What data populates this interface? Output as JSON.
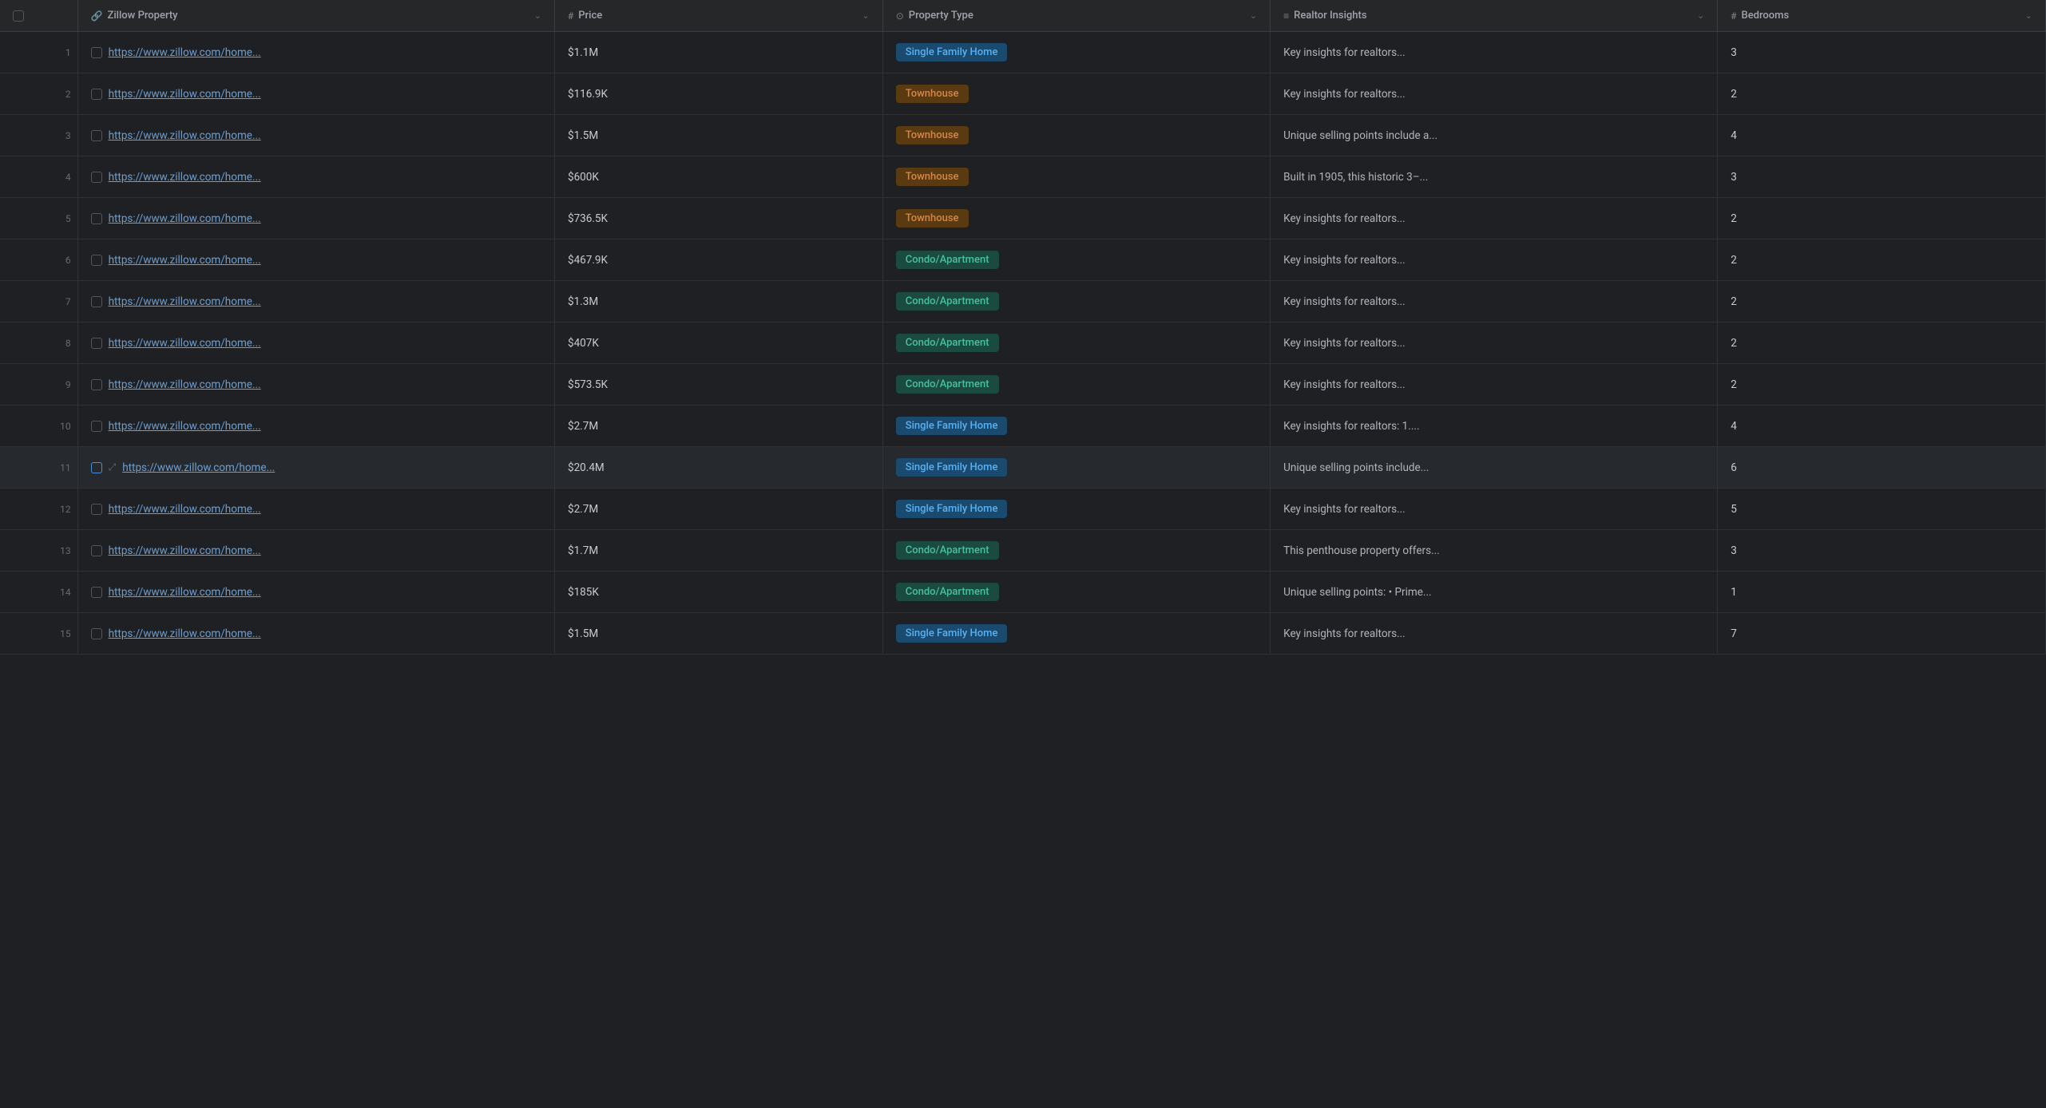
{
  "colors": {
    "bg": "#1e2023",
    "headerBg": "#252729",
    "rowHover": "#262a2e",
    "border": "#2e3135",
    "headerBorder": "#3a3d42",
    "text": "#c8ccd2",
    "subtext": "#a0a4ab",
    "rowNum": "#666b75",
    "link": "#6b9fd4",
    "singleFamilyBg": "#1a4a6e",
    "singleFamilyText": "#5ab0f0",
    "townhouseBg": "#5a3a10",
    "townhouseText": "#d4864a",
    "condoBg": "#1a4a40",
    "condoText": "#4abfa0"
  },
  "columns": [
    {
      "id": "row-num",
      "label": "",
      "icon": ""
    },
    {
      "id": "zillow",
      "label": "Zillow Property",
      "icon": "🔗"
    },
    {
      "id": "price",
      "label": "Price",
      "icon": "#"
    },
    {
      "id": "property-type",
      "label": "Property Type",
      "icon": "⊙"
    },
    {
      "id": "realtor-insights",
      "label": "Realtor Insights",
      "icon": "≡"
    },
    {
      "id": "bedrooms",
      "label": "Bedrooms",
      "icon": "#"
    }
  ],
  "rows": [
    {
      "num": 1,
      "url": "https://www.zillow.com/home...",
      "price": "$1.1M",
      "property_type": "Single Family Home",
      "property_type_class": "single-family",
      "insights": "Key insights for realtors...",
      "bedrooms": "3",
      "checked": false,
      "highlighted": false
    },
    {
      "num": 2,
      "url": "https://www.zillow.com/home...",
      "price": "$116.9K",
      "property_type": "Townhouse",
      "property_type_class": "townhouse",
      "insights": "Key insights for realtors...",
      "bedrooms": "2",
      "checked": false,
      "highlighted": false
    },
    {
      "num": 3,
      "url": "https://www.zillow.com/home...",
      "price": "$1.5M",
      "property_type": "Townhouse",
      "property_type_class": "townhouse",
      "insights": "Unique selling points include a...",
      "bedrooms": "4",
      "checked": false,
      "highlighted": false
    },
    {
      "num": 4,
      "url": "https://www.zillow.com/home...",
      "price": "$600K",
      "property_type": "Townhouse",
      "property_type_class": "townhouse",
      "insights": "Built in 1905, this historic 3–...",
      "bedrooms": "3",
      "checked": false,
      "highlighted": false
    },
    {
      "num": 5,
      "url": "https://www.zillow.com/home...",
      "price": "$736.5K",
      "property_type": "Townhouse",
      "property_type_class": "townhouse",
      "insights": "Key insights for realtors...",
      "bedrooms": "2",
      "checked": false,
      "highlighted": false
    },
    {
      "num": 6,
      "url": "https://www.zillow.com/home...",
      "price": "$467.9K",
      "property_type": "Condo/Apartment",
      "property_type_class": "condo",
      "insights": "Key insights for realtors...",
      "bedrooms": "2",
      "checked": false,
      "highlighted": false
    },
    {
      "num": 7,
      "url": "https://www.zillow.com/home...",
      "price": "$1.3M",
      "property_type": "Condo/Apartment",
      "property_type_class": "condo",
      "insights": "Key insights for realtors...",
      "bedrooms": "2",
      "checked": false,
      "highlighted": false
    },
    {
      "num": 8,
      "url": "https://www.zillow.com/home...",
      "price": "$407K",
      "property_type": "Condo/Apartment",
      "property_type_class": "condo",
      "insights": "Key insights for realtors...",
      "bedrooms": "2",
      "checked": false,
      "highlighted": false
    },
    {
      "num": 9,
      "url": "https://www.zillow.com/home...",
      "price": "$573.5K",
      "property_type": "Condo/Apartment",
      "property_type_class": "condo",
      "insights": "Key insights for realtors...",
      "bedrooms": "2",
      "checked": false,
      "highlighted": false
    },
    {
      "num": 10,
      "url": "https://www.zillow.com/home...",
      "price": "$2.7M",
      "property_type": "Single Family Home",
      "property_type_class": "single-family",
      "insights": "Key insights for realtors: 1....",
      "bedrooms": "4",
      "checked": false,
      "highlighted": false
    },
    {
      "num": 11,
      "url": "https://www.zillow.com/home...",
      "price": "$20.4M",
      "property_type": "Single Family Home",
      "property_type_class": "single-family",
      "insights": "Unique selling points include...",
      "bedrooms": "6",
      "checked": false,
      "highlighted": true
    },
    {
      "num": 12,
      "url": "https://www.zillow.com/home...",
      "price": "$2.7M",
      "property_type": "Single Family Home",
      "property_type_class": "single-family",
      "insights": "Key insights for realtors...",
      "bedrooms": "5",
      "checked": false,
      "highlighted": false
    },
    {
      "num": 13,
      "url": "https://www.zillow.com/home...",
      "price": "$1.7M",
      "property_type": "Condo/Apartment",
      "property_type_class": "condo",
      "insights": "This penthouse property offers...",
      "bedrooms": "3",
      "checked": false,
      "highlighted": false
    },
    {
      "num": 14,
      "url": "https://www.zillow.com/home...",
      "price": "$185K",
      "property_type": "Condo/Apartment",
      "property_type_class": "condo",
      "insights": "Unique selling points: • Prime...",
      "bedrooms": "1",
      "checked": false,
      "highlighted": false
    },
    {
      "num": 15,
      "url": "https://www.zillow.com/home...",
      "price": "$1.5M",
      "property_type": "Single Family Home",
      "property_type_class": "single-family",
      "insights": "Key insights for realtors...",
      "bedrooms": "7",
      "checked": false,
      "highlighted": false
    }
  ]
}
